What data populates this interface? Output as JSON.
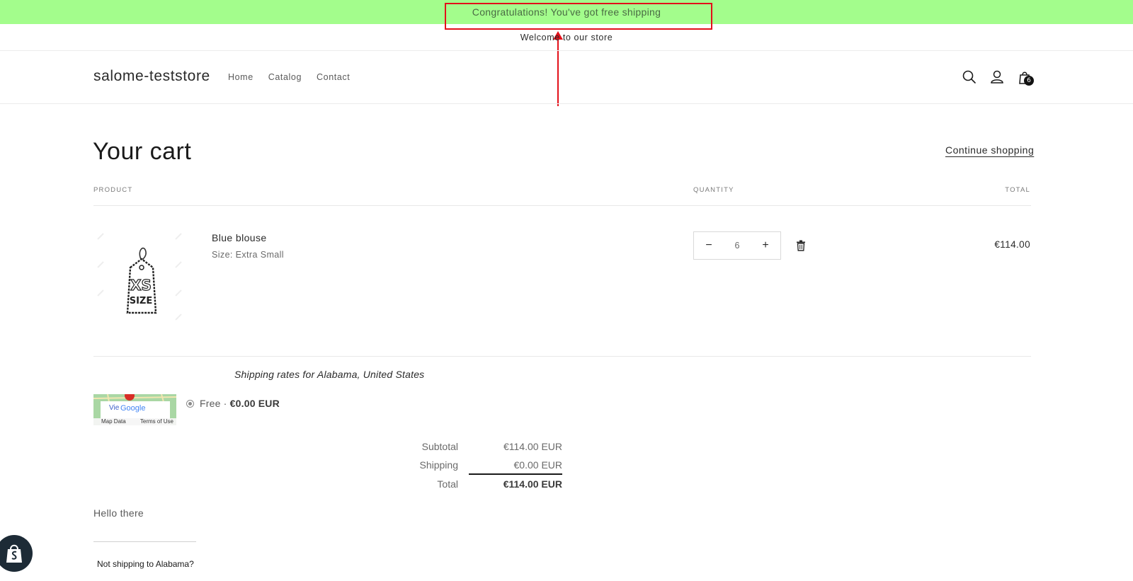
{
  "promo": {
    "text": "Congratulations! You've got free shipping",
    "bg_color": "#a3fd8c"
  },
  "annotation": {
    "color": "#e3101a"
  },
  "announcement": {
    "text": "Welcome to our store"
  },
  "header": {
    "logo": "salome-teststore",
    "nav": [
      "Home",
      "Catalog",
      "Contact"
    ],
    "icons": [
      "search-icon",
      "account-icon",
      "cart-icon"
    ],
    "cart_count": "6"
  },
  "cart": {
    "title": "Your cart",
    "continue_label": "Continue shopping",
    "columns": {
      "product": "PRODUCT",
      "quantity": "QUANTITY",
      "total": "TOTAL"
    },
    "items": [
      {
        "name": "Blue blouse",
        "variant": "Size: Extra Small",
        "image_text": [
          "XS",
          "SIZE"
        ],
        "quantity": "6",
        "line_total": "€114.00"
      }
    ]
  },
  "shipping": {
    "rates_title": "Shipping rates for Alabama, United States",
    "map": {
      "view": "Vie",
      "google": "Google",
      "map_data": "Map Data",
      "terms": "Terms of Use"
    },
    "rate_name": "Free · ",
    "rate_price": "€0.00 EUR"
  },
  "summary": {
    "subtotal_label": "Subtotal",
    "subtotal_value": "€114.00 EUR",
    "shipping_label": "Shipping",
    "shipping_value": "€0.00 EUR",
    "total_label": "Total",
    "total_value": "€114.00 EUR"
  },
  "note": {
    "text": "Hello there"
  },
  "not_shipping": "Not shipping to Alabama?"
}
